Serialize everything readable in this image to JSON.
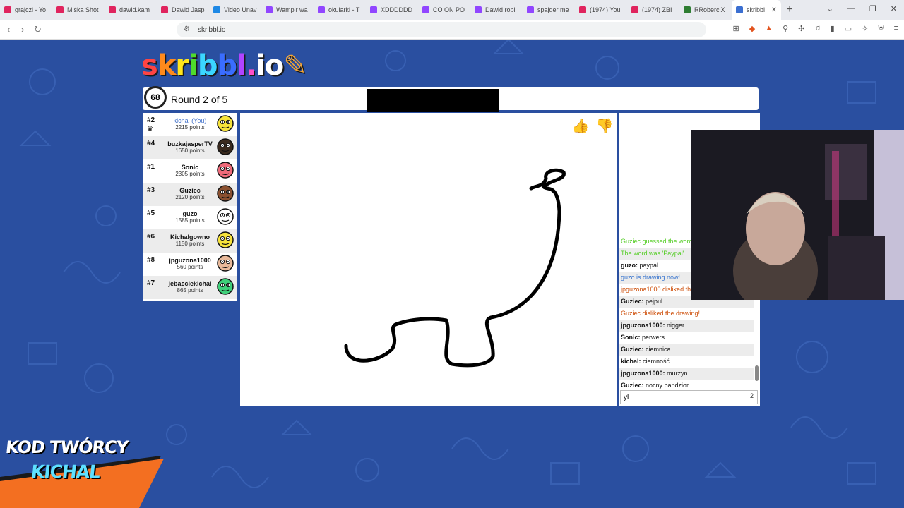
{
  "browser": {
    "tabs": [
      {
        "label": "grajczi - Yo",
        "color": "#e0245e"
      },
      {
        "label": "Miśka Shot",
        "color": "#e0245e"
      },
      {
        "label": "dawid.kam",
        "color": "#e0245e"
      },
      {
        "label": "Dawid Jasp",
        "color": "#e0245e"
      },
      {
        "label": "Video Unav",
        "color": "#1e88e5"
      },
      {
        "label": "Wampir wa",
        "color": "#9146ff"
      },
      {
        "label": "okularki - T",
        "color": "#9146ff"
      },
      {
        "label": "XDDDDDD",
        "color": "#9146ff"
      },
      {
        "label": "CO ON PO",
        "color": "#9146ff"
      },
      {
        "label": "Dawid robi",
        "color": "#9146ff"
      },
      {
        "label": "spajder me",
        "color": "#9146ff"
      },
      {
        "label": "(1974) You",
        "color": "#e0245e"
      },
      {
        "label": "(1974) ZBI",
        "color": "#e0245e"
      },
      {
        "label": "RRoberciX",
        "color": "#2e7d32"
      },
      {
        "label": "skribbl",
        "color": "#3b6fd1"
      }
    ],
    "new_tab": "+",
    "url": "skribbl.io"
  },
  "game": {
    "logo": "skribbl.io",
    "timer": "68",
    "round": "Round 2 of 5",
    "players": [
      {
        "rank": "#2",
        "name": "kichal (You)",
        "points": "2215 points",
        "you": true,
        "color": "#f7e33a"
      },
      {
        "rank": "#4",
        "name": "buzkajasperTV",
        "points": "1650 points",
        "color": "#3a2a1e"
      },
      {
        "rank": "#1",
        "name": "Sonic",
        "points": "2305 points",
        "color": "#f06a7a"
      },
      {
        "rank": "#3",
        "name": "Guziec",
        "points": "2120 points",
        "color": "#8a5030"
      },
      {
        "rank": "#5",
        "name": "guzo",
        "points": "1585 points",
        "color": "#ffffff"
      },
      {
        "rank": "#6",
        "name": "Kichalgowno",
        "points": "1150 points",
        "color": "#f7e33a"
      },
      {
        "rank": "#8",
        "name": "jpguzona1000",
        "points": "560 points",
        "color": "#e9b99a"
      },
      {
        "rank": "#7",
        "name": "jebacciekichal",
        "points": "865 points",
        "color": "#3fd07a"
      }
    ],
    "rating": {
      "like": "👍",
      "dislike": "👎"
    }
  },
  "chat": {
    "messages": [
      {
        "type": "green",
        "text": "Guziec guessed the word!"
      },
      {
        "type": "green",
        "text": "The word was 'Paypal'"
      },
      {
        "type": "normal",
        "name": "guzo:",
        "text": " paypal"
      },
      {
        "type": "blue",
        "text": "guzo is drawing now!"
      },
      {
        "type": "red",
        "text": "jpguzona1000 disliked the drawing!"
      },
      {
        "type": "normal",
        "name": "Guziec:",
        "text": " pejpul"
      },
      {
        "type": "red",
        "text": "Guziec disliked the drawing!"
      },
      {
        "type": "normal",
        "name": "jpguzona1000:",
        "text": " nigger"
      },
      {
        "type": "normal",
        "name": "Sonic:",
        "text": " perwers"
      },
      {
        "type": "normal",
        "name": "Guziec:",
        "text": " ciemnica"
      },
      {
        "type": "normal",
        "name": "kichal:",
        "text": " ciemność"
      },
      {
        "type": "normal",
        "name": "jpguzona1000:",
        "text": " murzyn"
      },
      {
        "type": "normal",
        "name": "Guziec:",
        "text": " nocny bandzior"
      }
    ],
    "input_value": "yl",
    "char_count": "2"
  },
  "promo": {
    "line1": "KOD TWÓRCY",
    "line2": "KICHAL"
  }
}
